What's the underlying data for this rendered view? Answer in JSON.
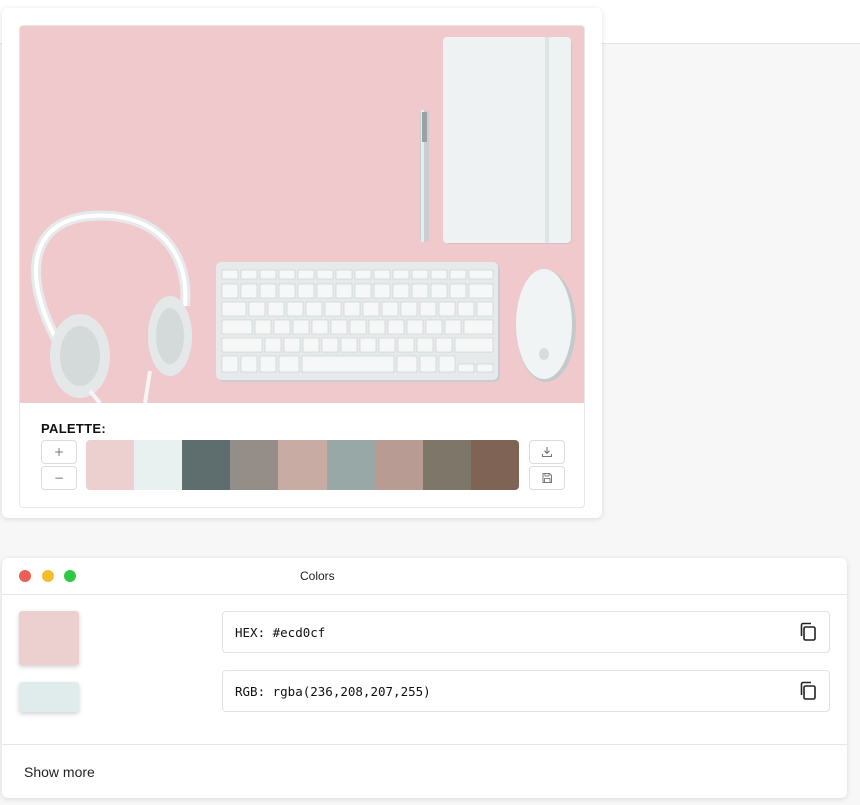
{
  "palette": {
    "title": "PALETTE:",
    "add_label": "+",
    "remove_label": "−",
    "download_icon": "download-icon",
    "save_icon": "save-icon",
    "swatches": [
      "#ecd0cf",
      "#e8f0f0",
      "#5e6e6e",
      "#958e88",
      "#c8aca4",
      "#97a8a6",
      "#b89b93",
      "#7e7668",
      "#7f6456"
    ]
  },
  "colors_window": {
    "title": "Colors",
    "traffic_lights": [
      "#ec5f57",
      "#f4bd2f",
      "#2fc842"
    ],
    "selected_swatch": "#ecd0cf",
    "secondary_swatch": "#e0ecec",
    "hex_text": "HEX: #ecd0cf",
    "rgb_text": "RGB: rgba(236,208,207,255)",
    "copy_icon": "copy-icon",
    "show_more": "Show more"
  }
}
